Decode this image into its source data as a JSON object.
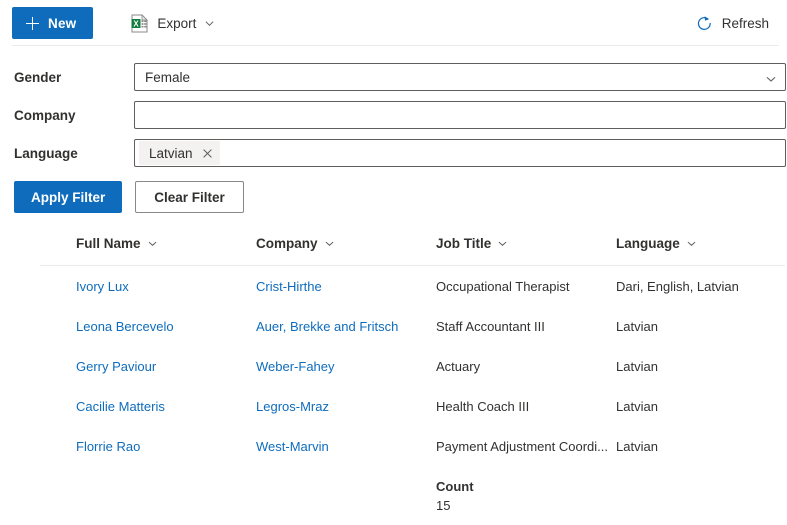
{
  "toolbar": {
    "new_label": "New",
    "export_label": "Export",
    "refresh_label": "Refresh",
    "accent_color": "#0f6cbd"
  },
  "filters": {
    "gender": {
      "label": "Gender",
      "value": "Female",
      "placeholder": ""
    },
    "company": {
      "label": "Company",
      "value": "",
      "placeholder": ""
    },
    "language": {
      "label": "Language",
      "tags": [
        "Latvian"
      ],
      "placeholder": ""
    },
    "apply_label": "Apply Filter",
    "clear_label": "Clear Filter"
  },
  "table": {
    "columns": [
      {
        "label": "Full Name"
      },
      {
        "label": "Company"
      },
      {
        "label": "Job Title"
      },
      {
        "label": "Language"
      }
    ],
    "rows": [
      {
        "full_name": "Ivory Lux",
        "company": "Crist-Hirthe",
        "job_title": "Occupational Therapist",
        "language": "Dari, English, Latvian"
      },
      {
        "full_name": "Leona Bercevelo",
        "company": "Auer, Brekke and Fritsch",
        "job_title": "Staff Accountant III",
        "language": "Latvian"
      },
      {
        "full_name": "Gerry Paviour",
        "company": "Weber-Fahey",
        "job_title": "Actuary",
        "language": "Latvian"
      },
      {
        "full_name": "Cacilie Matteris",
        "company": "Legros-Mraz",
        "job_title": "Health Coach III",
        "language": "Latvian"
      },
      {
        "full_name": "Florrie Rao",
        "company": "West-Marvin",
        "job_title": "Payment Adjustment Coordi...",
        "language": "Latvian"
      }
    ],
    "footer": {
      "count_label": "Count",
      "count_value": "15"
    }
  }
}
